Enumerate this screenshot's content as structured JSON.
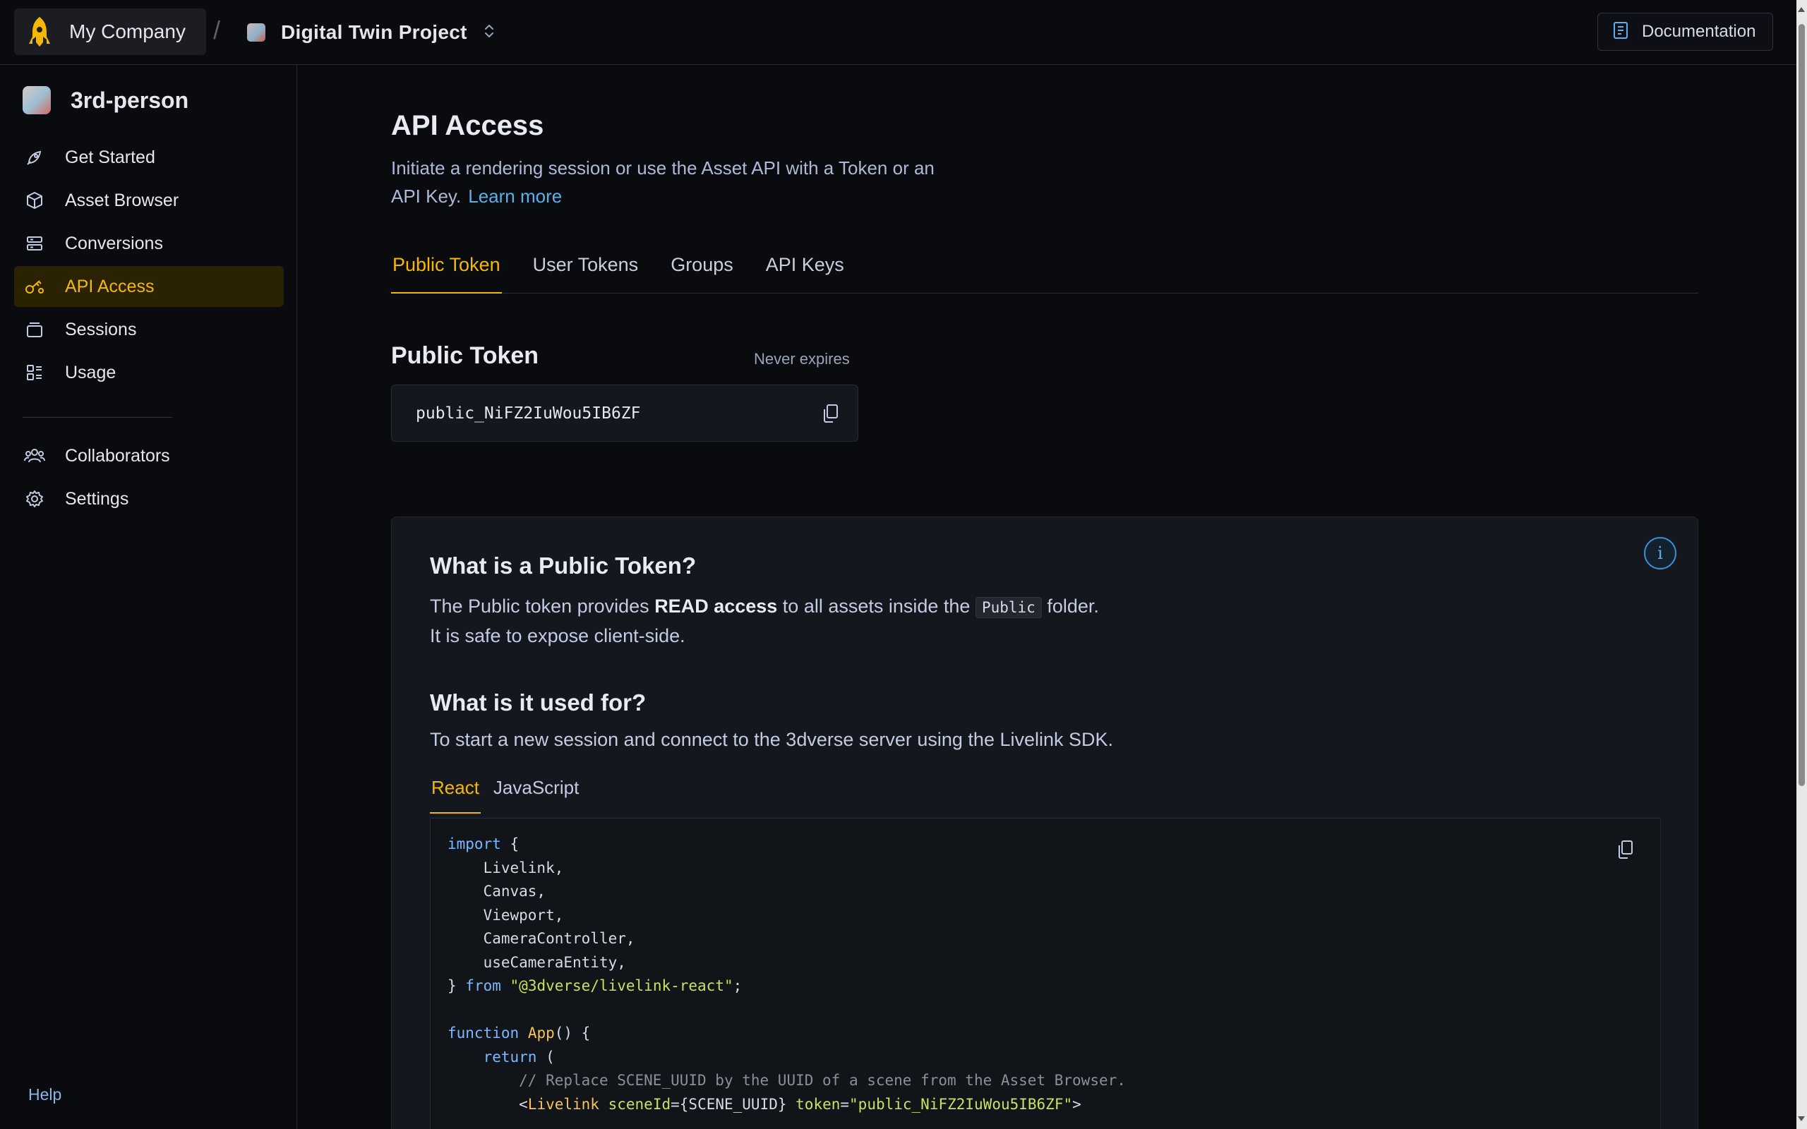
{
  "topbar": {
    "company": "My Company",
    "separator": "/",
    "project": "Digital Twin Project",
    "docs_label": "Documentation"
  },
  "sidebar": {
    "workspace": "3rd-person",
    "items": [
      {
        "label": "Get Started",
        "icon": "rocket-icon"
      },
      {
        "label": "Asset Browser",
        "icon": "cube-icon"
      },
      {
        "label": "Conversions",
        "icon": "conversion-icon"
      },
      {
        "label": "API Access",
        "icon": "key-icon",
        "active": true
      },
      {
        "label": "Sessions",
        "icon": "sessions-icon"
      },
      {
        "label": "Usage",
        "icon": "usage-icon"
      }
    ],
    "items2": [
      {
        "label": "Collaborators",
        "icon": "users-icon"
      },
      {
        "label": "Settings",
        "icon": "gear-icon"
      }
    ],
    "help": "Help"
  },
  "main": {
    "title": "API Access",
    "description": "Initiate a rendering session or use the Asset API with a Token or an API Key.",
    "learn_more": "Learn more",
    "tabs": [
      "Public Token",
      "User Tokens",
      "Groups",
      "API Keys"
    ],
    "active_tab": "Public Token",
    "public_token": {
      "title": "Public Token",
      "expiry": "Never expires",
      "value": "public_NiFZ2IuWou5IB6ZF"
    },
    "info": {
      "q1": "What is a Public Token?",
      "a1_pre": "The Public token provides ",
      "a1_bold": "READ access",
      "a1_mid": " to all assets inside the ",
      "a1_code": "Public",
      "a1_post": " folder.",
      "a1_line2": "It is safe to expose client-side.",
      "q2": "What is it used for?",
      "a2": "To start a new session and connect to the 3dverse server using the Livelink SDK.",
      "code_tabs": [
        "React",
        "JavaScript"
      ],
      "active_code_tab": "React",
      "code": {
        "l1_kw": "import",
        "l1_rest": " {",
        "imports": [
          "Livelink,",
          "Canvas,",
          "Viewport,",
          "CameraController,",
          "useCameraEntity,"
        ],
        "from_kw": "from",
        "module": "\"@3dverse/livelink-react\"",
        "fn_kw": "function",
        "fn_name": "App",
        "return_kw": "return",
        "comment": "// Replace SCENE_UUID by the UUID of a scene from the Asset Browser.",
        "tag": "Livelink",
        "attr1": "sceneId",
        "attr1_val": "{SCENE_UUID}",
        "attr2": "token",
        "attr2_val": "\"public_NiFZ2IuWou5IB6ZF\""
      }
    }
  },
  "colors": {
    "accent": "#f5b800",
    "link": "#5ab0ea",
    "background": "#0a0b0f",
    "card": "#14171e"
  }
}
